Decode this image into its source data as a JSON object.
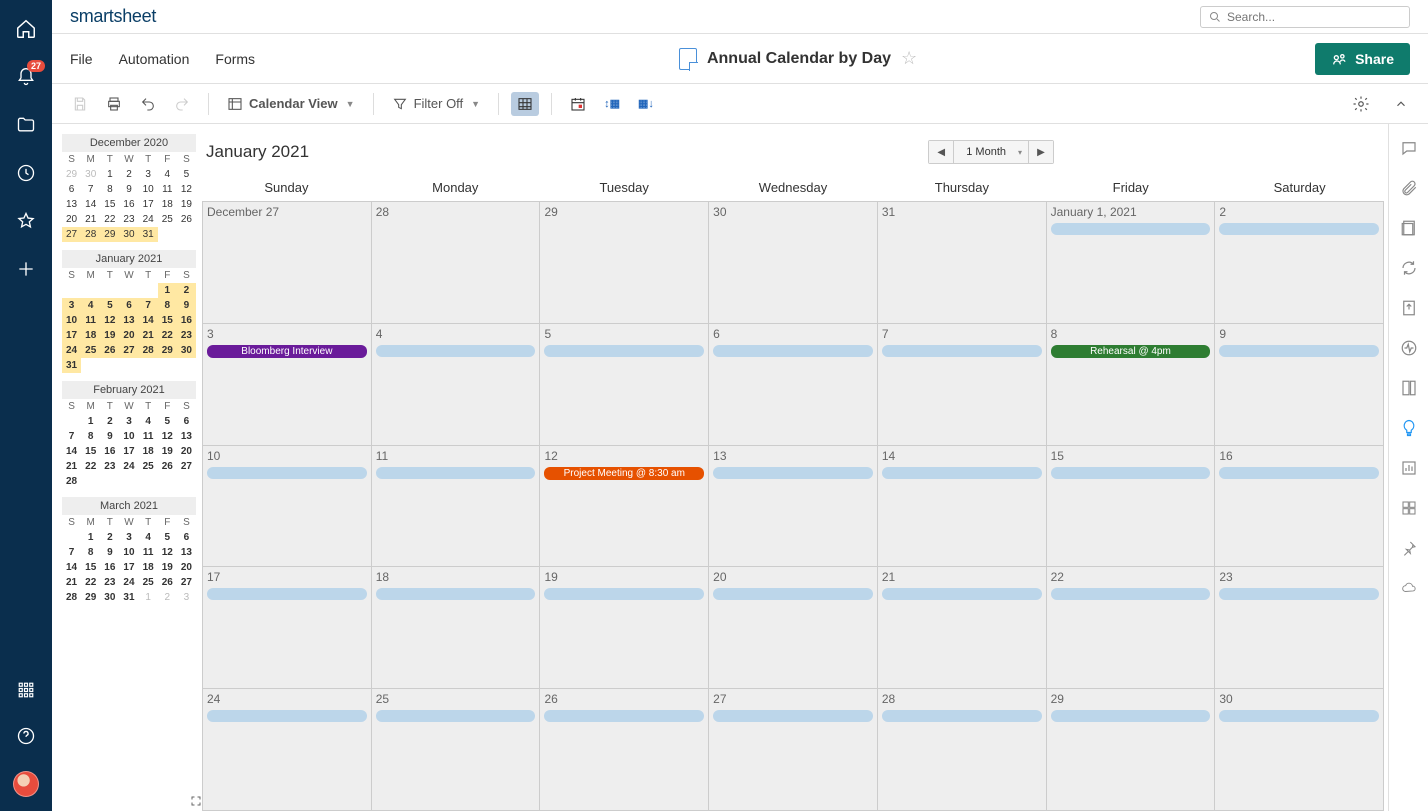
{
  "app": {
    "logo": "smartsheet",
    "notification_count": "27"
  },
  "search": {
    "placeholder": "Search..."
  },
  "menu": {
    "file": "File",
    "automation": "Automation",
    "forms": "Forms"
  },
  "sheet": {
    "title": "Annual Calendar by Day"
  },
  "share": {
    "label": "Share"
  },
  "toolbar": {
    "view_label": "Calendar View",
    "filter_label": "Filter Off"
  },
  "calendar": {
    "title": "January 2021",
    "period": "1 Month",
    "days_of_week": [
      "Sunday",
      "Monday",
      "Tuesday",
      "Wednesday",
      "Thursday",
      "Friday",
      "Saturday"
    ],
    "weeks": [
      [
        {
          "label": "December 27",
          "bar": false
        },
        {
          "label": "28",
          "bar": false
        },
        {
          "label": "29",
          "bar": false
        },
        {
          "label": "30",
          "bar": false
        },
        {
          "label": "31",
          "bar": false
        },
        {
          "label": "January 1, 2021",
          "bar": true
        },
        {
          "label": "2",
          "bar": true
        }
      ],
      [
        {
          "label": "3",
          "bar": false,
          "event": {
            "text": "Bloomberg Interview",
            "cls": "ev-purple"
          }
        },
        {
          "label": "4",
          "bar": true
        },
        {
          "label": "5",
          "bar": true
        },
        {
          "label": "6",
          "bar": true
        },
        {
          "label": "7",
          "bar": true
        },
        {
          "label": "8",
          "bar": false,
          "event": {
            "text": "Rehearsal @ 4pm",
            "cls": "ev-green"
          }
        },
        {
          "label": "9",
          "bar": true
        }
      ],
      [
        {
          "label": "10",
          "bar": true
        },
        {
          "label": "11",
          "bar": true
        },
        {
          "label": "12",
          "bar": false,
          "event": {
            "text": "Project Meeting @ 8:30 am",
            "cls": "ev-orange"
          }
        },
        {
          "label": "13",
          "bar": true
        },
        {
          "label": "14",
          "bar": true
        },
        {
          "label": "15",
          "bar": true
        },
        {
          "label": "16",
          "bar": true
        }
      ],
      [
        {
          "label": "17",
          "bar": true
        },
        {
          "label": "18",
          "bar": true
        },
        {
          "label": "19",
          "bar": true
        },
        {
          "label": "20",
          "bar": true
        },
        {
          "label": "21",
          "bar": true
        },
        {
          "label": "22",
          "bar": true
        },
        {
          "label": "23",
          "bar": true
        }
      ],
      [
        {
          "label": "24",
          "bar": true
        },
        {
          "label": "25",
          "bar": true
        },
        {
          "label": "26",
          "bar": true
        },
        {
          "label": "27",
          "bar": true
        },
        {
          "label": "28",
          "bar": true
        },
        {
          "label": "29",
          "bar": true
        },
        {
          "label": "30",
          "bar": true
        }
      ]
    ]
  },
  "mini": {
    "dow": [
      "S",
      "M",
      "T",
      "W",
      "T",
      "F",
      "S"
    ],
    "months": [
      {
        "title": "December 2020",
        "rows": [
          [
            {
              "n": "29",
              "dim": true
            },
            {
              "n": "30",
              "dim": true
            },
            {
              "n": "1"
            },
            {
              "n": "2"
            },
            {
              "n": "3"
            },
            {
              "n": "4"
            },
            {
              "n": "5"
            }
          ],
          [
            {
              "n": "6"
            },
            {
              "n": "7"
            },
            {
              "n": "8"
            },
            {
              "n": "9"
            },
            {
              "n": "10"
            },
            {
              "n": "11"
            },
            {
              "n": "12"
            }
          ],
          [
            {
              "n": "13"
            },
            {
              "n": "14"
            },
            {
              "n": "15"
            },
            {
              "n": "16"
            },
            {
              "n": "17"
            },
            {
              "n": "18"
            },
            {
              "n": "19"
            }
          ],
          [
            {
              "n": "20"
            },
            {
              "n": "21"
            },
            {
              "n": "22"
            },
            {
              "n": "23"
            },
            {
              "n": "24"
            },
            {
              "n": "25"
            },
            {
              "n": "26"
            }
          ],
          [
            {
              "n": "27",
              "hl": true
            },
            {
              "n": "28",
              "hl": true
            },
            {
              "n": "29",
              "hl": true
            },
            {
              "n": "30",
              "hl": true
            },
            {
              "n": "31",
              "hl": true
            },
            {
              "n": ""
            },
            {
              "n": ""
            }
          ]
        ]
      },
      {
        "title": "January 2021",
        "rows": [
          [
            {
              "n": ""
            },
            {
              "n": ""
            },
            {
              "n": ""
            },
            {
              "n": ""
            },
            {
              "n": ""
            },
            {
              "n": "1",
              "hl": true,
              "b": true
            },
            {
              "n": "2",
              "hl": true,
              "b": true
            }
          ],
          [
            {
              "n": "3",
              "hl": true,
              "b": true
            },
            {
              "n": "4",
              "hl": true,
              "b": true
            },
            {
              "n": "5",
              "hl": true,
              "b": true
            },
            {
              "n": "6",
              "hl": true,
              "b": true
            },
            {
              "n": "7",
              "hl": true,
              "b": true
            },
            {
              "n": "8",
              "hl": true,
              "b": true
            },
            {
              "n": "9",
              "hl": true,
              "b": true
            }
          ],
          [
            {
              "n": "10",
              "hl": true,
              "b": true
            },
            {
              "n": "11",
              "hl": true,
              "b": true
            },
            {
              "n": "12",
              "hl": true,
              "b": true
            },
            {
              "n": "13",
              "hl": true,
              "b": true
            },
            {
              "n": "14",
              "hl": true,
              "b": true
            },
            {
              "n": "15",
              "hl": true,
              "b": true
            },
            {
              "n": "16",
              "hl": true,
              "b": true
            }
          ],
          [
            {
              "n": "17",
              "hl": true,
              "b": true
            },
            {
              "n": "18",
              "hl": true,
              "b": true
            },
            {
              "n": "19",
              "hl": true,
              "b": true
            },
            {
              "n": "20",
              "hl": true,
              "b": true
            },
            {
              "n": "21",
              "hl": true,
              "b": true
            },
            {
              "n": "22",
              "hl": true,
              "b": true
            },
            {
              "n": "23",
              "hl": true,
              "b": true
            }
          ],
          [
            {
              "n": "24",
              "hl": true,
              "b": true
            },
            {
              "n": "25",
              "hl": true,
              "b": true
            },
            {
              "n": "26",
              "hl": true,
              "b": true
            },
            {
              "n": "27",
              "hl": true,
              "b": true
            },
            {
              "n": "28",
              "hl": true,
              "b": true
            },
            {
              "n": "29",
              "hl": true,
              "b": true
            },
            {
              "n": "30",
              "hl": true,
              "b": true
            }
          ],
          [
            {
              "n": "31",
              "hl": true,
              "b": true
            },
            {
              "n": ""
            },
            {
              "n": ""
            },
            {
              "n": ""
            },
            {
              "n": ""
            },
            {
              "n": ""
            },
            {
              "n": ""
            }
          ]
        ]
      },
      {
        "title": "February 2021",
        "rows": [
          [
            {
              "n": ""
            },
            {
              "n": "1",
              "b": true
            },
            {
              "n": "2",
              "b": true
            },
            {
              "n": "3",
              "b": true
            },
            {
              "n": "4",
              "b": true
            },
            {
              "n": "5",
              "b": true
            },
            {
              "n": "6",
              "b": true
            }
          ],
          [
            {
              "n": "7",
              "b": true
            },
            {
              "n": "8",
              "b": true
            },
            {
              "n": "9",
              "b": true
            },
            {
              "n": "10",
              "b": true
            },
            {
              "n": "11",
              "b": true
            },
            {
              "n": "12",
              "b": true
            },
            {
              "n": "13",
              "b": true
            }
          ],
          [
            {
              "n": "14",
              "b": true
            },
            {
              "n": "15",
              "b": true
            },
            {
              "n": "16",
              "b": true
            },
            {
              "n": "17",
              "b": true
            },
            {
              "n": "18",
              "b": true
            },
            {
              "n": "19",
              "b": true
            },
            {
              "n": "20",
              "b": true
            }
          ],
          [
            {
              "n": "21",
              "b": true
            },
            {
              "n": "22",
              "b": true
            },
            {
              "n": "23",
              "b": true
            },
            {
              "n": "24",
              "b": true
            },
            {
              "n": "25",
              "b": true
            },
            {
              "n": "26",
              "b": true
            },
            {
              "n": "27",
              "b": true
            }
          ],
          [
            {
              "n": "28",
              "b": true
            },
            {
              "n": ""
            },
            {
              "n": ""
            },
            {
              "n": ""
            },
            {
              "n": ""
            },
            {
              "n": ""
            },
            {
              "n": ""
            }
          ]
        ]
      },
      {
        "title": "March 2021",
        "rows": [
          [
            {
              "n": ""
            },
            {
              "n": "1",
              "b": true
            },
            {
              "n": "2",
              "b": true
            },
            {
              "n": "3",
              "b": true
            },
            {
              "n": "4",
              "b": true
            },
            {
              "n": "5",
              "b": true
            },
            {
              "n": "6",
              "b": true
            }
          ],
          [
            {
              "n": "7",
              "b": true
            },
            {
              "n": "8",
              "b": true
            },
            {
              "n": "9",
              "b": true
            },
            {
              "n": "10",
              "b": true
            },
            {
              "n": "11",
              "b": true
            },
            {
              "n": "12",
              "b": true
            },
            {
              "n": "13",
              "b": true
            }
          ],
          [
            {
              "n": "14",
              "b": true
            },
            {
              "n": "15",
              "b": true
            },
            {
              "n": "16",
              "b": true
            },
            {
              "n": "17",
              "b": true
            },
            {
              "n": "18",
              "b": true
            },
            {
              "n": "19",
              "b": true
            },
            {
              "n": "20",
              "b": true
            }
          ],
          [
            {
              "n": "21",
              "b": true
            },
            {
              "n": "22",
              "b": true
            },
            {
              "n": "23",
              "b": true
            },
            {
              "n": "24",
              "b": true
            },
            {
              "n": "25",
              "b": true
            },
            {
              "n": "26",
              "b": true
            },
            {
              "n": "27",
              "b": true
            }
          ],
          [
            {
              "n": "28",
              "b": true
            },
            {
              "n": "29",
              "b": true
            },
            {
              "n": "30",
              "b": true
            },
            {
              "n": "31",
              "b": true
            },
            {
              "n": "1",
              "dim": true
            },
            {
              "n": "2",
              "dim": true
            },
            {
              "n": "3",
              "dim": true
            }
          ]
        ]
      }
    ]
  }
}
